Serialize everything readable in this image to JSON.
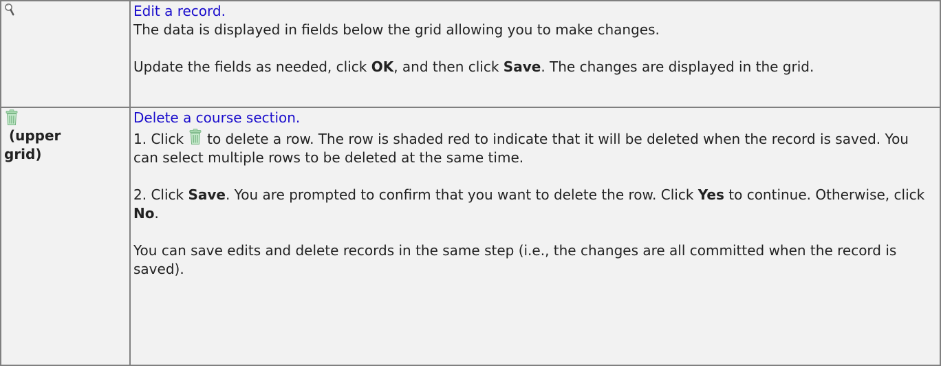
{
  "rows": {
    "edit": {
      "icon": "magnifier-icon",
      "link": "Edit a record.",
      "line1": "The data is displayed in fields below the grid allowing you to make changes.",
      "p2": {
        "a": "Update the fields as needed, click ",
        "b1": "OK",
        "c": ", and then click ",
        "b2": "Save",
        "d": ". The changes are displayed in the grid."
      }
    },
    "delete": {
      "icon": "trash-icon",
      "scope_line1": "(upper",
      "scope_line2": "grid)",
      "link": "Delete a course section.",
      "step1": {
        "a": "1. Click",
        "b": "to delete a row. The row is shaded red to indicate that it will be deleted when the record is saved. You can select multiple rows to be deleted at the same time."
      },
      "step2": {
        "a": "2. Click ",
        "b1": "Save",
        "c": ". You are prompted to confirm that you want to delete the row. Click ",
        "b2": "Yes",
        "d": " to continue. Otherwise, click ",
        "b3": "No",
        "e": "."
      },
      "note": "You can save edits and delete records in the same step (i.e., the changes are all committed when the record is saved)."
    }
  },
  "colors": {
    "link": "#1a0dcc",
    "cell_bg": "#f2f2f2",
    "border": "#808080",
    "trash_icon": "#7fbf8a"
  }
}
